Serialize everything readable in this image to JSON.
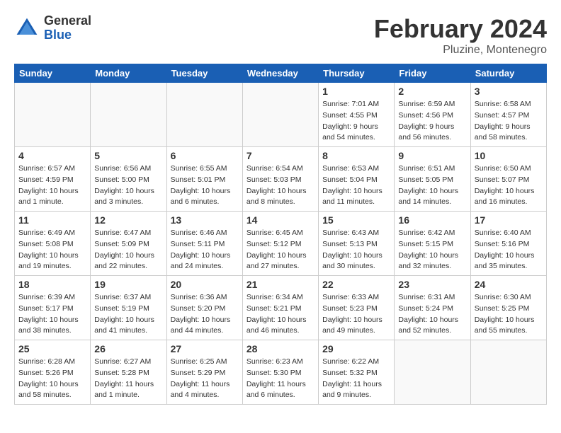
{
  "header": {
    "logo_general": "General",
    "logo_blue": "Blue",
    "month_title": "February 2024",
    "location": "Pluzine, Montenegro"
  },
  "days_of_week": [
    "Sunday",
    "Monday",
    "Tuesday",
    "Wednesday",
    "Thursday",
    "Friday",
    "Saturday"
  ],
  "weeks": [
    [
      {
        "day": "",
        "info": ""
      },
      {
        "day": "",
        "info": ""
      },
      {
        "day": "",
        "info": ""
      },
      {
        "day": "",
        "info": ""
      },
      {
        "day": "1",
        "info": "Sunrise: 7:01 AM\nSunset: 4:55 PM\nDaylight: 9 hours\nand 54 minutes."
      },
      {
        "day": "2",
        "info": "Sunrise: 6:59 AM\nSunset: 4:56 PM\nDaylight: 9 hours\nand 56 minutes."
      },
      {
        "day": "3",
        "info": "Sunrise: 6:58 AM\nSunset: 4:57 PM\nDaylight: 9 hours\nand 58 minutes."
      }
    ],
    [
      {
        "day": "4",
        "info": "Sunrise: 6:57 AM\nSunset: 4:59 PM\nDaylight: 10 hours\nand 1 minute."
      },
      {
        "day": "5",
        "info": "Sunrise: 6:56 AM\nSunset: 5:00 PM\nDaylight: 10 hours\nand 3 minutes."
      },
      {
        "day": "6",
        "info": "Sunrise: 6:55 AM\nSunset: 5:01 PM\nDaylight: 10 hours\nand 6 minutes."
      },
      {
        "day": "7",
        "info": "Sunrise: 6:54 AM\nSunset: 5:03 PM\nDaylight: 10 hours\nand 8 minutes."
      },
      {
        "day": "8",
        "info": "Sunrise: 6:53 AM\nSunset: 5:04 PM\nDaylight: 10 hours\nand 11 minutes."
      },
      {
        "day": "9",
        "info": "Sunrise: 6:51 AM\nSunset: 5:05 PM\nDaylight: 10 hours\nand 14 minutes."
      },
      {
        "day": "10",
        "info": "Sunrise: 6:50 AM\nSunset: 5:07 PM\nDaylight: 10 hours\nand 16 minutes."
      }
    ],
    [
      {
        "day": "11",
        "info": "Sunrise: 6:49 AM\nSunset: 5:08 PM\nDaylight: 10 hours\nand 19 minutes."
      },
      {
        "day": "12",
        "info": "Sunrise: 6:47 AM\nSunset: 5:09 PM\nDaylight: 10 hours\nand 22 minutes."
      },
      {
        "day": "13",
        "info": "Sunrise: 6:46 AM\nSunset: 5:11 PM\nDaylight: 10 hours\nand 24 minutes."
      },
      {
        "day": "14",
        "info": "Sunrise: 6:45 AM\nSunset: 5:12 PM\nDaylight: 10 hours\nand 27 minutes."
      },
      {
        "day": "15",
        "info": "Sunrise: 6:43 AM\nSunset: 5:13 PM\nDaylight: 10 hours\nand 30 minutes."
      },
      {
        "day": "16",
        "info": "Sunrise: 6:42 AM\nSunset: 5:15 PM\nDaylight: 10 hours\nand 32 minutes."
      },
      {
        "day": "17",
        "info": "Sunrise: 6:40 AM\nSunset: 5:16 PM\nDaylight: 10 hours\nand 35 minutes."
      }
    ],
    [
      {
        "day": "18",
        "info": "Sunrise: 6:39 AM\nSunset: 5:17 PM\nDaylight: 10 hours\nand 38 minutes."
      },
      {
        "day": "19",
        "info": "Sunrise: 6:37 AM\nSunset: 5:19 PM\nDaylight: 10 hours\nand 41 minutes."
      },
      {
        "day": "20",
        "info": "Sunrise: 6:36 AM\nSunset: 5:20 PM\nDaylight: 10 hours\nand 44 minutes."
      },
      {
        "day": "21",
        "info": "Sunrise: 6:34 AM\nSunset: 5:21 PM\nDaylight: 10 hours\nand 46 minutes."
      },
      {
        "day": "22",
        "info": "Sunrise: 6:33 AM\nSunset: 5:23 PM\nDaylight: 10 hours\nand 49 minutes."
      },
      {
        "day": "23",
        "info": "Sunrise: 6:31 AM\nSunset: 5:24 PM\nDaylight: 10 hours\nand 52 minutes."
      },
      {
        "day": "24",
        "info": "Sunrise: 6:30 AM\nSunset: 5:25 PM\nDaylight: 10 hours\nand 55 minutes."
      }
    ],
    [
      {
        "day": "25",
        "info": "Sunrise: 6:28 AM\nSunset: 5:26 PM\nDaylight: 10 hours\nand 58 minutes."
      },
      {
        "day": "26",
        "info": "Sunrise: 6:27 AM\nSunset: 5:28 PM\nDaylight: 11 hours\nand 1 minute."
      },
      {
        "day": "27",
        "info": "Sunrise: 6:25 AM\nSunset: 5:29 PM\nDaylight: 11 hours\nand 4 minutes."
      },
      {
        "day": "28",
        "info": "Sunrise: 6:23 AM\nSunset: 5:30 PM\nDaylight: 11 hours\nand 6 minutes."
      },
      {
        "day": "29",
        "info": "Sunrise: 6:22 AM\nSunset: 5:32 PM\nDaylight: 11 hours\nand 9 minutes."
      },
      {
        "day": "",
        "info": ""
      },
      {
        "day": "",
        "info": ""
      }
    ]
  ]
}
